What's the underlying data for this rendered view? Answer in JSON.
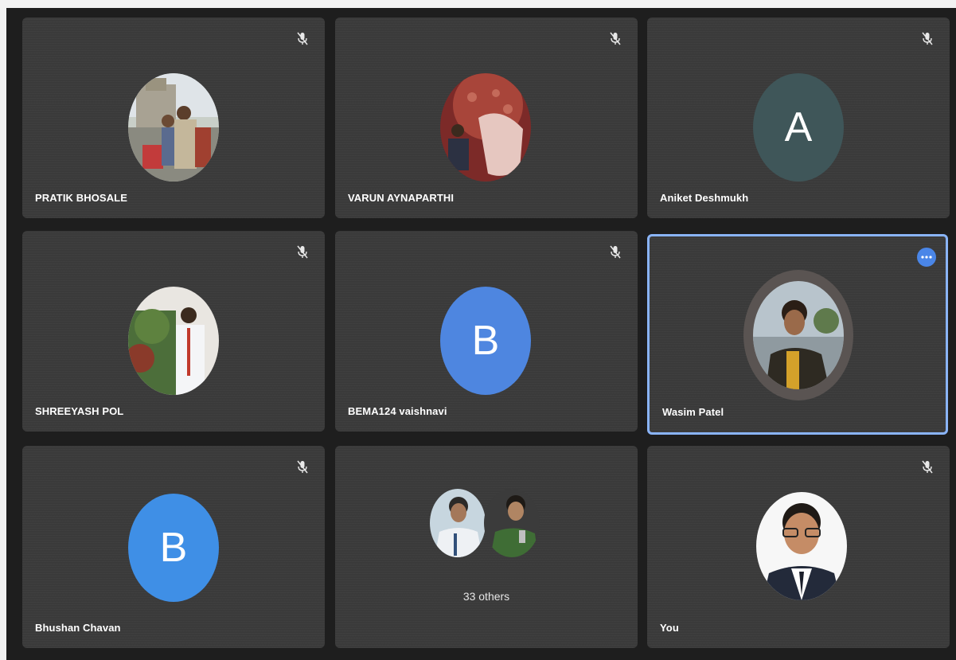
{
  "participants": [
    {
      "name": "PRATIK BHOSALE",
      "muted": true
    },
    {
      "name": "VARUN AYNAPARTHI",
      "muted": true
    },
    {
      "name": "Aniket Deshmukh",
      "muted": true,
      "initial": "A",
      "color": "#3f5659"
    },
    {
      "name": "SHREEYASH POL",
      "muted": true
    },
    {
      "name": "BEMA124 vaishnavi",
      "muted": true,
      "initial": "B",
      "color": "#4e86e0"
    },
    {
      "name": "Wasim Patel",
      "muted": false,
      "active": true
    },
    {
      "name": "Bhushan Chavan",
      "muted": true,
      "initial": "B",
      "color": "#3f8fe6"
    },
    {
      "others_label": "33 others"
    },
    {
      "name": "You",
      "muted": true
    }
  ],
  "colors": {
    "active_border": "#8ab4f8",
    "tile_bg": "#3a3a3a",
    "stage_bg": "#1e1e1e"
  },
  "icons": {
    "mute": "mic-off-icon",
    "more": "more-options-icon"
  }
}
